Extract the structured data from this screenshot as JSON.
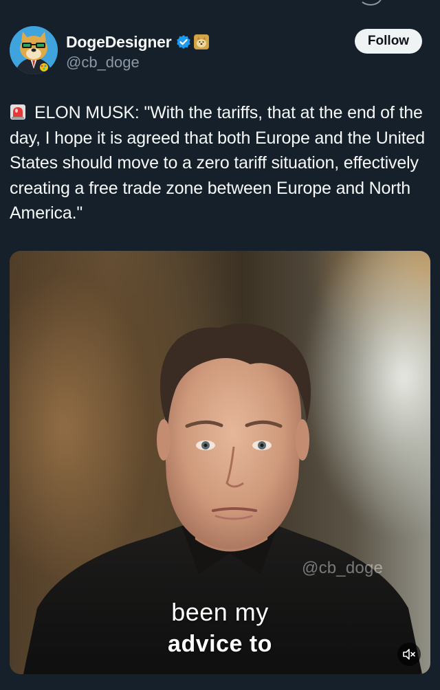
{
  "author": {
    "display_name": "DogeDesigner",
    "handle": "@cb_doge",
    "verified": true,
    "avatar_icon": "doge-avatar-icon",
    "badge_icon": "doge-badge-icon"
  },
  "follow_button": {
    "label": "Follow"
  },
  "tweet": {
    "emoji_icon": "siren-icon",
    "text": "ELON MUSK: \"With the tariffs, that at the end of the day, I hope it is agreed that both Europe and the United States should move to a zero tariff situation, effectively creating a free trade zone between Europe and North America.\""
  },
  "video": {
    "watermark": "@cb_doge",
    "caption_line1": "been my",
    "caption_line2": "advice to",
    "mute_icon": "speaker-muted-icon"
  },
  "colors": {
    "background": "#15202b",
    "text": "#f7f9f9",
    "secondary_text": "#8b98a5",
    "verified_blue": "#1d9bf0",
    "follow_button_bg": "#eff3f4"
  }
}
